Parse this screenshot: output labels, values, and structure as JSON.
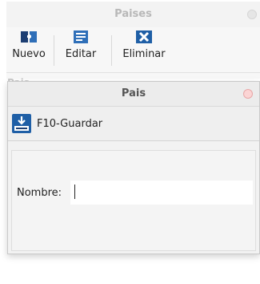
{
  "background_window": {
    "title": "Paises",
    "ghost_label": "Pais",
    "toolbar": {
      "nuevo": {
        "label": "Nuevo",
        "icon": "new-record-icon"
      },
      "editar": {
        "label": "Editar",
        "icon": "edit-record-icon"
      },
      "eliminar": {
        "label": "Eliminar",
        "icon": "delete-record-icon"
      }
    }
  },
  "dialog": {
    "title": "Pais",
    "toolbar": {
      "save": {
        "label": "F10-Guardar",
        "icon": "save-download-icon"
      }
    },
    "form": {
      "nombre_label": "Nombre:",
      "nombre_value": ""
    }
  },
  "colors": {
    "icon_blue": "#1f5fa6",
    "icon_dark": "#1d3f73",
    "close_dot": "#fbd4d4"
  }
}
